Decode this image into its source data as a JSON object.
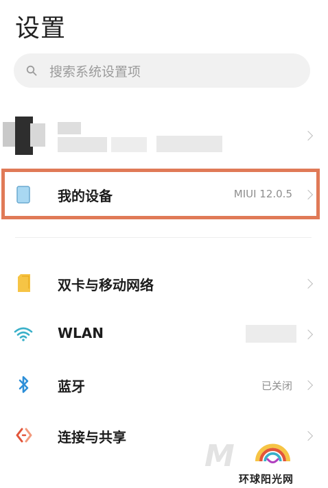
{
  "header": {
    "title": "设置"
  },
  "search": {
    "placeholder": "搜索系统设置项",
    "icon": "search-icon"
  },
  "account": {
    "icon": "avatar",
    "chevron": "chevron-right-icon"
  },
  "rows": [
    {
      "id": "my-device",
      "label": "我的设备",
      "value": "MIUI 12.0.5",
      "icon": "phone-icon",
      "highlighted": true
    },
    {
      "id": "dual-sim",
      "label": "双卡与移动网络",
      "value": "",
      "icon": "sim-card-icon"
    },
    {
      "id": "wlan",
      "label": "WLAN",
      "value": "",
      "icon": "wifi-icon"
    },
    {
      "id": "bluetooth",
      "label": "蓝牙",
      "value": "已关闭",
      "icon": "bluetooth-icon"
    },
    {
      "id": "connection",
      "label": "连接与共享",
      "value": "",
      "icon": "share-icon"
    }
  ],
  "colors": {
    "highlight_border": "#e07a57",
    "sim": "#f6c445",
    "wifi": "#3ab0c9",
    "bluetooth": "#2d8fd8",
    "share": "#e2553a",
    "device": "#9fd1ee"
  },
  "watermark": {
    "text": "环球阳光网",
    "letter": "M"
  }
}
